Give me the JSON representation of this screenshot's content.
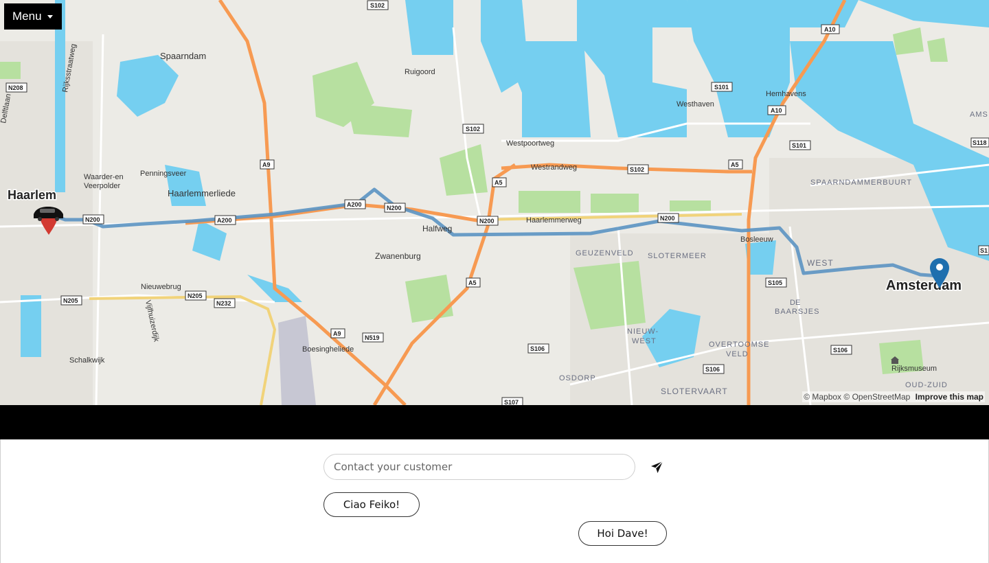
{
  "menu": {
    "label": "Menu"
  },
  "map": {
    "places": {
      "haarlem": "Haarlem",
      "amsterdam": "Amsterdam",
      "spaarndam": "Spaarndam",
      "ruigoord": "Ruigoord",
      "westhaven": "Westhaven",
      "hemhavens": "Hemhavens",
      "westpoortweg": "Westpoortweg",
      "westrandweg": "Westrandweg",
      "penningsveer": "Penningsveer",
      "waarder": "Waarder-en",
      "veerpolder": "Veerpolder",
      "haarlemmerliede": "Haarlemmerliede",
      "halfweg": "Halfweg",
      "haarlemmerweg": "Haarlemmerweg",
      "zwanenburg": "Zwanenburg",
      "bosleeuw": "Bosleeuw",
      "geuzenveld": "GEUZENVELD",
      "slotermeer": "SLOTERMEER",
      "west": "WEST",
      "spaarndammerbuurt": "SPAARNDAMMERBUURT",
      "de": "DE",
      "baarsjes": "BAARSJES",
      "nieuw": "NIEUW-",
      "west2": "WEST",
      "overtoomse": "OVERTOOMSE",
      "veld": "VELD",
      "osdorp": "OSDORP",
      "slotervaart": "SLOTERVAART",
      "rijksmuseum": "Rijksmuseum",
      "nieuwebrug": "Nieuwebrug",
      "schalkwijk": "Schalkwijk",
      "boesingheliede": "Boesingheliede",
      "rijksstraatweg": "Rijksstraatweg",
      "vijfhuizerdijk": "Vijfhuizerdijk",
      "delftlaan": "Delftlaan",
      "oudzuid": "OUD-ZUID",
      "ams": "AMS"
    },
    "shields": {
      "s102a": "S102",
      "s102b": "S102",
      "s102c": "S102",
      "a10a": "A10",
      "a10b": "A10",
      "s101a": "S101",
      "s101b": "S101",
      "n208": "N208",
      "a9a": "A9",
      "a9b": "A9",
      "a5a": "A5",
      "a5b": "A5",
      "a5c": "A5",
      "s118": "S118",
      "n200a": "N200",
      "n200b": "N200",
      "n200c": "N200",
      "n200d": "N200",
      "a200a": "A200",
      "a200b": "A200",
      "s105": "S105",
      "s106a": "S106",
      "s106b": "S106",
      "s106c": "S106",
      "n205a": "N205",
      "n205b": "N205",
      "n232": "N232",
      "n519": "N519",
      "s107": "S107",
      "s1": "S1"
    },
    "attribution": {
      "mapbox": "© Mapbox",
      "osm": "© OpenStreetMap",
      "improve": "Improve this map"
    },
    "colors": {
      "water": "#75cff0",
      "route": "#5b93c2",
      "motorway": "#f79a52",
      "park": "#b7e0a0",
      "land": "#ecebe6"
    }
  },
  "chat": {
    "input_placeholder": "Contact your customer",
    "send_icon": "paper-plane-icon",
    "messages": [
      {
        "side": "left",
        "text": "Ciao Feiko!"
      },
      {
        "side": "right",
        "text": "Hoi Dave!"
      }
    ]
  }
}
